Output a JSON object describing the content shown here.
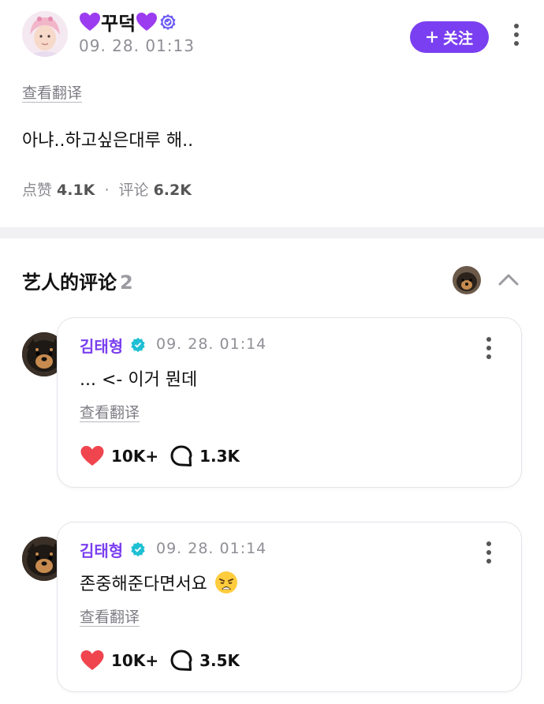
{
  "post": {
    "author": "꾸덕",
    "time": "09. 28. 01:13",
    "follow_label": "关注",
    "translate": "查看翻译",
    "text": "아냐..하고싶은대루 해..",
    "likes_label": "点赞",
    "likes": "4.1K",
    "sep": "·",
    "comments_label": "评论",
    "comments": "6.2K"
  },
  "section": {
    "title": "艺人的评论",
    "count": "2"
  },
  "comments": [
    {
      "name": "김태형",
      "time": "09. 28. 01:14",
      "text": "... <- 이거 뭔데",
      "translate": "查看翻译",
      "likes": "10K+",
      "replies": "1.3K"
    },
    {
      "name": "김태형",
      "time": "09. 28. 01:14",
      "text": "존중해준다면서요",
      "translate": "查看翻译",
      "likes": "10K+",
      "replies": "3.5K"
    }
  ],
  "colors": {
    "accent": "#7a3ff0",
    "heart": "#9b3cf0",
    "like": "#f0454f",
    "verified": "#1fbfd4"
  },
  "icons": [
    "purple-heart-icon",
    "verified-badge-icon",
    "plus-icon",
    "more-vertical-icon",
    "chevron-up-icon",
    "heart-icon",
    "comment-bubble-icon",
    "weary-face-emoji"
  ]
}
